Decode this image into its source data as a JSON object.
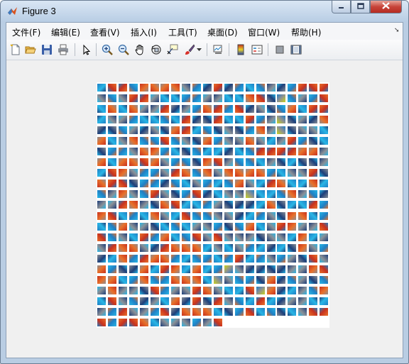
{
  "window": {
    "title": "Figure 3"
  },
  "menu": {
    "items": [
      {
        "label": "文件(F)"
      },
      {
        "label": "编辑(E)"
      },
      {
        "label": "查看(V)"
      },
      {
        "label": "插入(I)"
      },
      {
        "label": "工具(T)"
      },
      {
        "label": "桌面(D)"
      },
      {
        "label": "窗口(W)"
      },
      {
        "label": "帮助(H)"
      }
    ]
  },
  "toolbar": {
    "tools": [
      {
        "icon": "new-figure-icon"
      },
      {
        "icon": "open-file-icon"
      },
      {
        "icon": "save-icon"
      },
      {
        "icon": "print-icon"
      },
      {
        "icon": "edit-plot-arrow-icon"
      },
      {
        "icon": "zoom-in-icon"
      },
      {
        "icon": "zoom-out-icon"
      },
      {
        "icon": "pan-hand-icon"
      },
      {
        "icon": "rotate-3d-icon"
      },
      {
        "icon": "data-cursor-icon"
      },
      {
        "icon": "brush-icon"
      },
      {
        "icon": "link-plot-icon"
      },
      {
        "icon": "colorbar-icon"
      },
      {
        "icon": "legend-icon"
      },
      {
        "icon": "hide-plot-tools-icon"
      },
      {
        "icon": "show-plot-tools-icon"
      }
    ]
  },
  "figure": {
    "grid_columns": 22,
    "grid_rows": 23,
    "tile_count": 496,
    "colors": {
      "blue": "#1f7fc4",
      "cyan": "#29b6e6",
      "navy": "#1d3f7a",
      "orange": "#e8702a",
      "red": "#c8321e",
      "gray": "#8a8f96",
      "yellow": "#c8d21e"
    }
  }
}
